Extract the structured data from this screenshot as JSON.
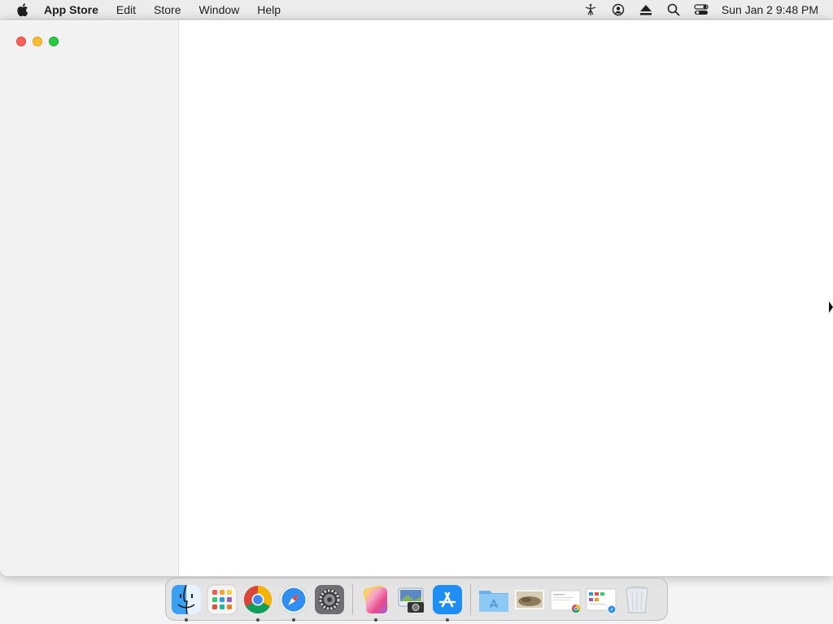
{
  "menubar": {
    "apple_icon": "apple-logo-icon",
    "items": [
      {
        "label": "App Store",
        "bold": true
      },
      {
        "label": "Edit"
      },
      {
        "label": "Store"
      },
      {
        "label": "Window"
      },
      {
        "label": "Help"
      }
    ],
    "status_icons": [
      "accessibility-icon",
      "user-account-icon",
      "eject-icon",
      "spotlight-search-icon",
      "control-center-icon"
    ],
    "clock": "Sun Jan 2  9:48 PM"
  },
  "window": {
    "app": "App Store",
    "traffic_lights": {
      "close_color": "#ff5f57",
      "minimize_color": "#febc2e",
      "zoom_color": "#28c840"
    }
  },
  "dock": {
    "apps": [
      {
        "icon": "finder-icon",
        "running": true
      },
      {
        "icon": "launchpad-icon",
        "running": false
      },
      {
        "icon": "chrome-icon",
        "running": true
      },
      {
        "icon": "safari-icon",
        "running": true
      },
      {
        "icon": "system-preferences-icon",
        "running": false
      },
      {
        "icon": "color-picker-icon",
        "running": true
      },
      {
        "icon": "preview-icon",
        "running": false
      },
      {
        "icon": "app-store-icon",
        "running": true
      }
    ],
    "others": [
      {
        "icon": "applications-folder-icon"
      },
      {
        "icon": "photo-thumbnail-icon"
      },
      {
        "icon": "document-chrome-icon"
      },
      {
        "icon": "document-safari-icon"
      },
      {
        "icon": "trash-icon"
      }
    ]
  }
}
